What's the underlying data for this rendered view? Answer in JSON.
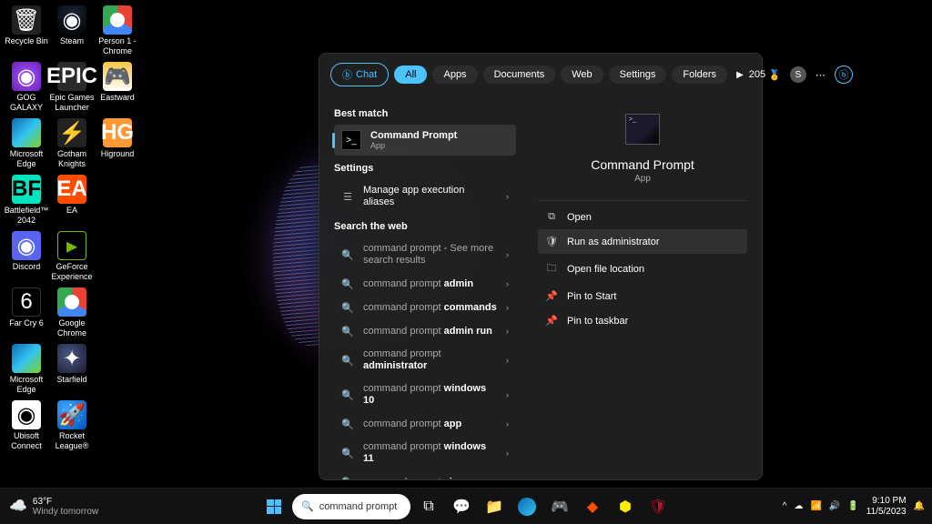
{
  "desktop": {
    "icons": [
      {
        "label": "Recycle Bin",
        "cls": "bg-recycle",
        "glyph": "🗑"
      },
      {
        "label": "GOG GALAXY",
        "cls": "bg-gog",
        "glyph": "◉"
      },
      {
        "label": "Microsoft Edge",
        "cls": "bg-edge",
        "glyph": ""
      },
      {
        "label": "Battlefield™ 2042",
        "cls": "bg-bf",
        "glyph": "BF"
      },
      {
        "label": "Discord",
        "cls": "bg-discord",
        "glyph": "◉"
      },
      {
        "label": "Far Cry 6",
        "cls": "bg-fc6",
        "glyph": "6"
      },
      {
        "label": "Microsoft Edge",
        "cls": "bg-edge",
        "glyph": ""
      },
      {
        "label": "Ubisoft Connect",
        "cls": "bg-ubi",
        "glyph": "◉"
      },
      {
        "label": "Steam",
        "cls": "bg-steam",
        "glyph": "◉"
      },
      {
        "label": "Epic Games Launcher",
        "cls": "bg-epic",
        "glyph": "EPIC"
      },
      {
        "label": "Gotham Knights",
        "cls": "bg-gotham",
        "glyph": "⚡"
      },
      {
        "label": "EA",
        "cls": "bg-ea",
        "glyph": "EA"
      },
      {
        "label": "GeForce Experience",
        "cls": "bg-gf",
        "glyph": "▸"
      },
      {
        "label": "Google Chrome",
        "cls": "bg-chrome",
        "glyph": ""
      },
      {
        "label": "Starfield",
        "cls": "bg-starfield",
        "glyph": "✦"
      },
      {
        "label": "Rocket League®",
        "cls": "bg-rl",
        "glyph": "🚀"
      },
      {
        "label": "Person 1 - Chrome",
        "cls": "bg-chrome",
        "glyph": ""
      },
      {
        "label": "Eastward",
        "cls": "bg-eastward",
        "glyph": "🎮"
      },
      {
        "label": "Higround",
        "cls": "bg-higround",
        "glyph": "HG"
      }
    ]
  },
  "start": {
    "tabs": {
      "chat": "Chat",
      "all": "All",
      "apps": "Apps",
      "documents": "Documents",
      "web": "Web",
      "settings": "Settings",
      "folders": "Folders"
    },
    "points": "205",
    "avatar": "S",
    "section_best": "Best match",
    "best_match": {
      "title": "Command Prompt",
      "sub": "App"
    },
    "section_settings": "Settings",
    "settings_item": "Manage app execution aliases",
    "section_web": "Search the web",
    "web_items": [
      {
        "pre": "command prompt",
        "bold": "",
        "suf": " - See more search results"
      },
      {
        "pre": "command prompt ",
        "bold": "admin",
        "suf": ""
      },
      {
        "pre": "command prompt ",
        "bold": "commands",
        "suf": ""
      },
      {
        "pre": "command prompt ",
        "bold": "admin run",
        "suf": ""
      },
      {
        "pre": "command prompt ",
        "bold": "administrator",
        "suf": ""
      },
      {
        "pre": "command prompt ",
        "bold": "windows 10",
        "suf": ""
      },
      {
        "pre": "command prompt ",
        "bold": "app",
        "suf": ""
      },
      {
        "pre": "command prompt ",
        "bold": "windows 11",
        "suf": ""
      },
      {
        "pre": "command prompt ",
        "bold": "virus",
        "suf": ""
      }
    ],
    "preview": {
      "title": "Command Prompt",
      "sub": "App"
    },
    "actions": {
      "open": "Open",
      "admin": "Run as administrator",
      "location": "Open file location",
      "pin_start": "Pin to Start",
      "pin_task": "Pin to taskbar"
    }
  },
  "taskbar": {
    "weather": {
      "temp": "63°F",
      "cond": "Windy tomorrow"
    },
    "search": "command prompt",
    "time": "9:10 PM",
    "date": "11/5/2023"
  }
}
